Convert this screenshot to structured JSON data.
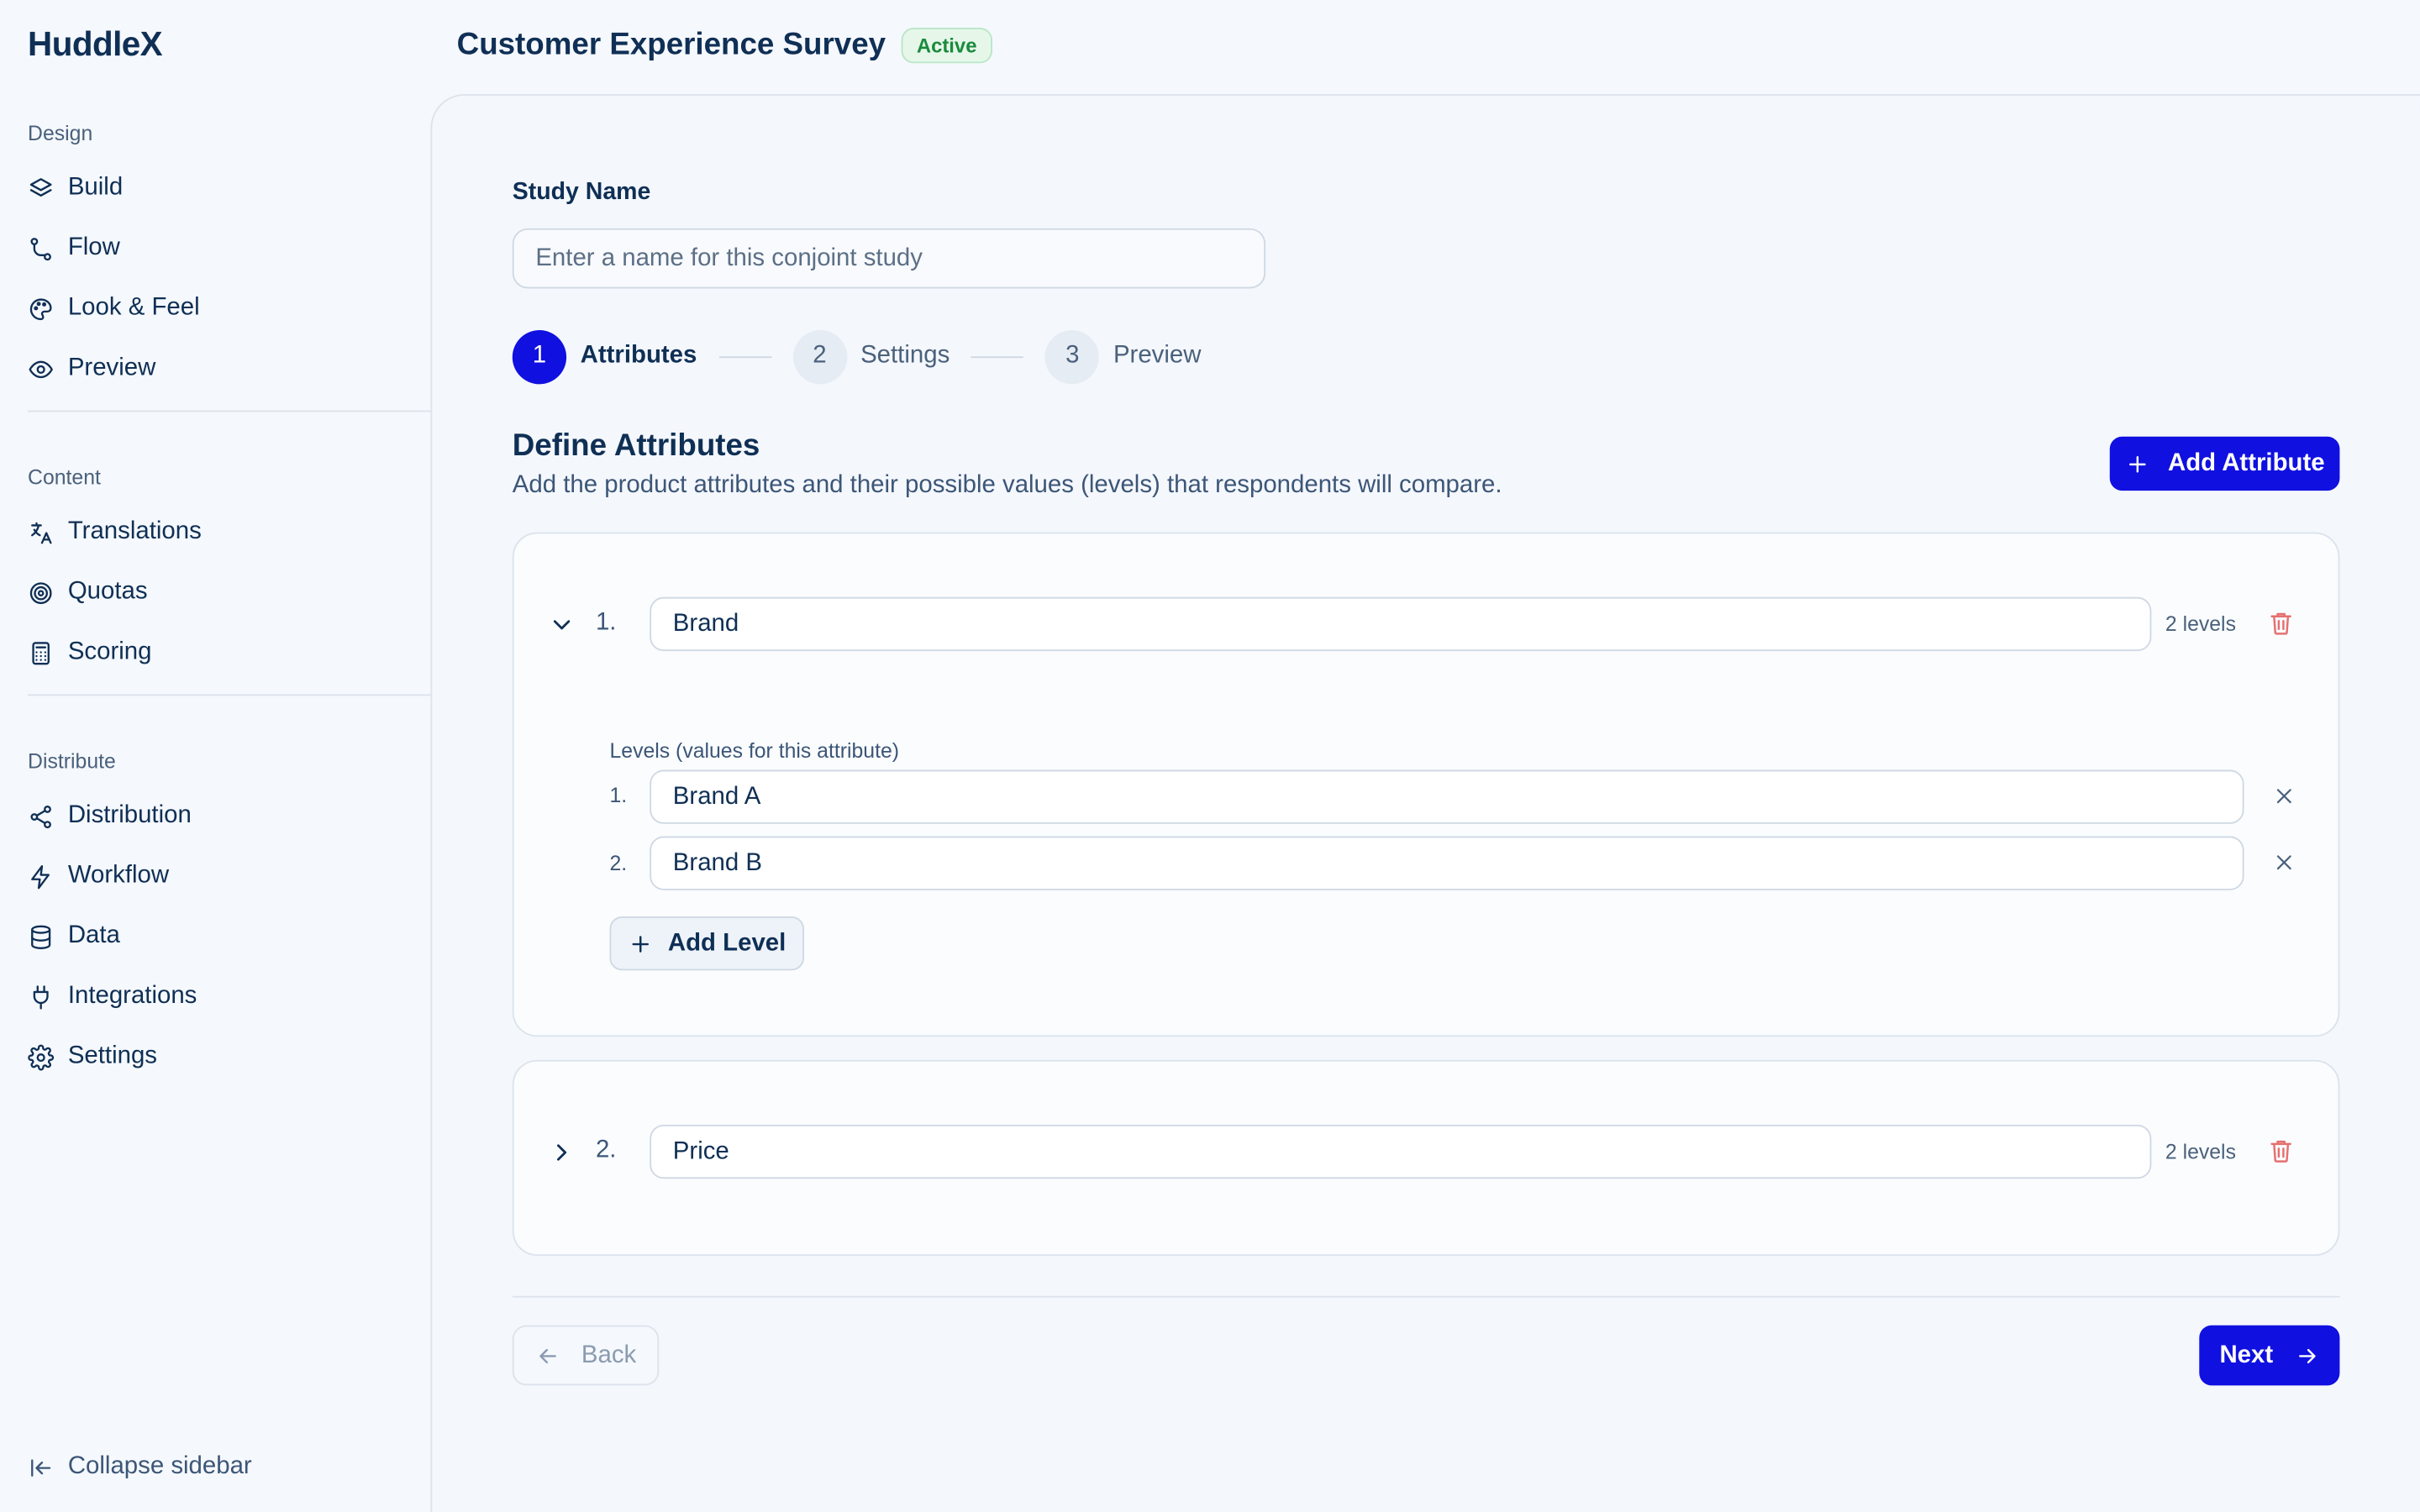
{
  "app": {
    "name": "HuddleX"
  },
  "header": {
    "title": "Customer Experience Survey",
    "status_badge": "Active"
  },
  "sidebar": {
    "sections": [
      {
        "label": "Design",
        "items": [
          {
            "label": "Build",
            "icon": "layers-icon"
          },
          {
            "label": "Flow",
            "icon": "flow-icon"
          },
          {
            "label": "Look & Feel",
            "icon": "palette-icon"
          },
          {
            "label": "Preview",
            "icon": "eye-icon"
          }
        ]
      },
      {
        "label": "Content",
        "items": [
          {
            "label": "Translations",
            "icon": "translate-icon"
          },
          {
            "label": "Quotas",
            "icon": "target-icon"
          },
          {
            "label": "Scoring",
            "icon": "calculator-icon"
          }
        ]
      },
      {
        "label": "Distribute",
        "items": [
          {
            "label": "Distribution",
            "icon": "share-icon"
          },
          {
            "label": "Workflow",
            "icon": "lightning-icon"
          },
          {
            "label": "Data",
            "icon": "database-icon"
          },
          {
            "label": "Integrations",
            "icon": "plug-icon"
          },
          {
            "label": "Settings",
            "icon": "gear-icon"
          }
        ]
      }
    ],
    "collapse_label": "Collapse sidebar"
  },
  "form": {
    "study_name_label": "Study Name",
    "study_name_placeholder": "Enter a name for this conjoint study",
    "study_name_value": ""
  },
  "stepper": {
    "steps": [
      {
        "number": "1",
        "label": "Attributes",
        "active": true
      },
      {
        "number": "2",
        "label": "Settings",
        "active": false
      },
      {
        "number": "3",
        "label": "Preview",
        "active": false
      }
    ]
  },
  "attributes_section": {
    "title": "Define Attributes",
    "subtitle": "Add the product attributes and their possible values (levels) that respondents will compare.",
    "add_attribute_label": "Add Attribute",
    "levels_label": "Levels (values for this attribute)",
    "add_level_label": "Add Level",
    "attributes": [
      {
        "index": "1.",
        "name": "Brand",
        "levels_count": "2 levels",
        "expanded": true,
        "levels": [
          {
            "index": "1.",
            "value": "Brand A"
          },
          {
            "index": "2.",
            "value": "Brand B"
          }
        ]
      },
      {
        "index": "2.",
        "name": "Price",
        "levels_count": "2 levels",
        "expanded": false,
        "levels": []
      }
    ]
  },
  "footer": {
    "back_label": "Back",
    "next_label": "Next"
  },
  "colors": {
    "primary": "#1010e0",
    "text": "#0f2f55",
    "active_badge": "#1a8a3c",
    "danger": "#e5706f"
  }
}
